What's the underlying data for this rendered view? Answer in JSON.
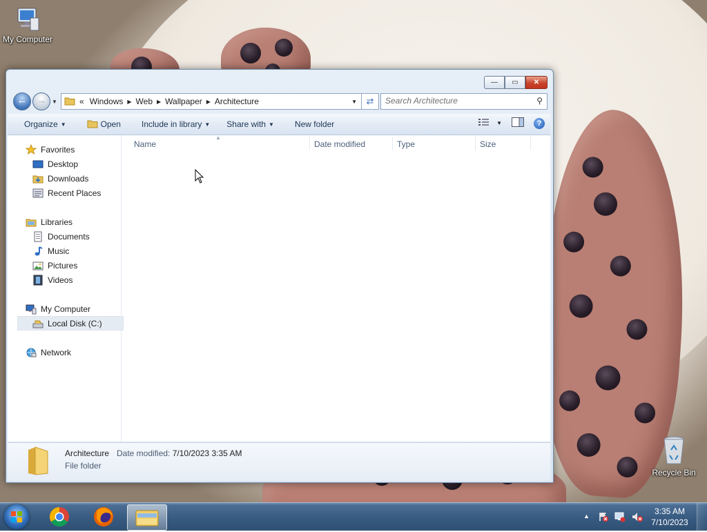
{
  "desktop": {
    "icons": [
      {
        "label": "My Computer"
      },
      {
        "label": "Recycle Bin"
      }
    ]
  },
  "window": {
    "title_buttons": {
      "minimize": "—",
      "maximize": "▭",
      "close": "✕"
    },
    "address": {
      "overflow": "«",
      "segments": [
        "Windows",
        "Web",
        "Wallpaper",
        "Architecture"
      ]
    },
    "search": {
      "placeholder": "Search Architecture"
    },
    "toolbar": {
      "organize": "Organize",
      "open": "Open",
      "include_in_library": "Include in library",
      "share_with": "Share with",
      "new_folder": "New folder"
    },
    "nav_pane": {
      "favorites": "Favorites",
      "desktop": "Desktop",
      "downloads": "Downloads",
      "recent_places": "Recent Places",
      "libraries": "Libraries",
      "documents": "Documents",
      "music": "Music",
      "pictures": "Pictures",
      "videos": "Videos",
      "my_computer": "My Computer",
      "local_disk": "Local Disk (C:)",
      "network": "Network"
    },
    "columns": [
      "Name",
      "Date modified",
      "Type",
      "Size"
    ],
    "details": {
      "name": "Architecture",
      "date_label": "Date modified:",
      "date_value": "7/10/2023 3:35 AM",
      "type": "File folder"
    }
  },
  "taskbar": {
    "time": "3:35 AM",
    "date": "7/10/2023"
  }
}
